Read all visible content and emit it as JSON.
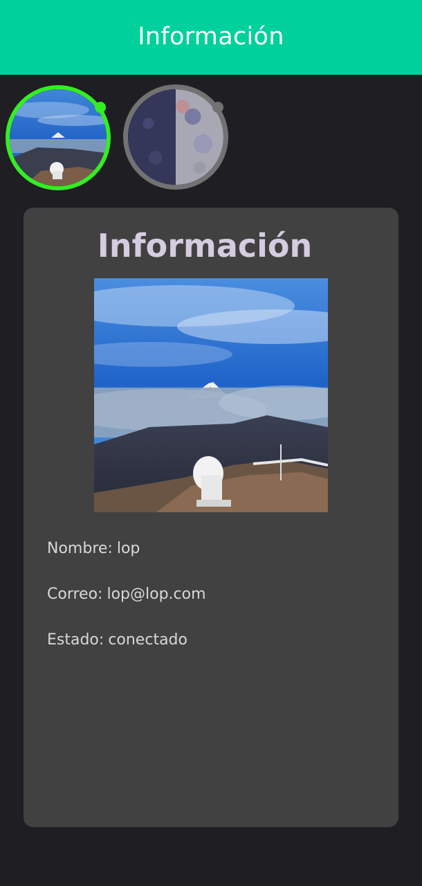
{
  "appbar": {
    "title": "Información"
  },
  "avatars": [
    {
      "name": "observatory-photo",
      "status_color": "#33ee22"
    },
    {
      "name": "moon-photo",
      "status_color": "#737273"
    }
  ],
  "card": {
    "title": "Información",
    "fields": [
      {
        "label": "Nombre:",
        "value": "lop"
      },
      {
        "label": "Correo:",
        "value": "lop@lop.com"
      },
      {
        "label": "Estado:",
        "value": "conectado"
      }
    ]
  },
  "colors": {
    "appbar": "#00d09b",
    "background": "#1f1e22",
    "card": "#414141",
    "online": "#33ee22",
    "offline": "#737273"
  }
}
